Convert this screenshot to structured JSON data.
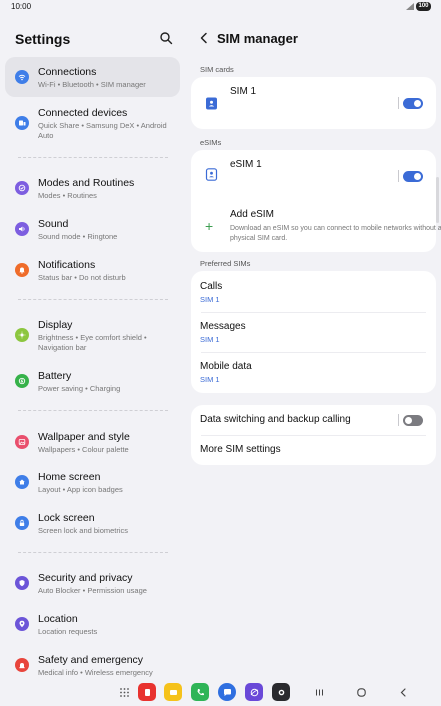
{
  "status": {
    "time": "10:00",
    "battery": "100"
  },
  "settings": {
    "title": "Settings",
    "items": [
      {
        "title": "Connections",
        "sub": "Wi-Fi  •  Bluetooth  •  SIM manager",
        "icon": "wifi-icon",
        "color": "#3f7ee8"
      },
      {
        "title": "Connected devices",
        "sub": "Quick Share  •  Samsung DeX  •  Android Auto",
        "icon": "devices-icon",
        "color": "#3f7ee8"
      },
      {
        "title": "Modes and Routines",
        "sub": "Modes  •  Routines",
        "icon": "check-circle-icon",
        "color": "#7d5ee0"
      },
      {
        "title": "Sound",
        "sub": "Sound mode  •  Ringtone",
        "icon": "speaker-icon",
        "color": "#7d5ee0"
      },
      {
        "title": "Notifications",
        "sub": "Status bar  •  Do not disturb",
        "icon": "bell-icon",
        "color": "#ef6c2a"
      },
      {
        "title": "Display",
        "sub": "Brightness  •  Eye comfort shield  •  Navigation bar",
        "icon": "sun-icon",
        "color": "#8cc63f"
      },
      {
        "title": "Battery",
        "sub": "Power saving  •  Charging",
        "icon": "battery-icon",
        "color": "#36b24a"
      },
      {
        "title": "Wallpaper and style",
        "sub": "Wallpapers  •  Colour palette",
        "icon": "image-icon",
        "color": "#e94f6d"
      },
      {
        "title": "Home screen",
        "sub": "Layout  •  App icon badges",
        "icon": "home-icon",
        "color": "#3f7ee8"
      },
      {
        "title": "Lock screen",
        "sub": "Screen lock and biometrics",
        "icon": "lock-icon",
        "color": "#3f7ee8"
      },
      {
        "title": "Security and privacy",
        "sub": "Auto Blocker  •  Permission usage",
        "icon": "shield-icon",
        "color": "#6c55d8"
      },
      {
        "title": "Location",
        "sub": "Location requests",
        "icon": "location-pin-icon",
        "color": "#6c55d8"
      },
      {
        "title": "Safety and emergency",
        "sub": "Medical info  •  Wireless emergency",
        "icon": "emergency-icon",
        "color": "#e8453c"
      }
    ]
  },
  "sim": {
    "title": "SIM manager",
    "section_sim_cards": "SIM cards",
    "sim1": "SIM 1",
    "section_esims": "eSIMs",
    "esim1": "eSIM 1",
    "add_esim": "Add eSIM",
    "add_esim_desc": "Download an eSIM so you can connect to mobile networks without a physical SIM card.",
    "section_preferred": "Preferred SIMs",
    "calls": "Calls",
    "calls_sim": "SIM 1",
    "messages": "Messages",
    "messages_sim": "SIM 1",
    "mobile_data": "Mobile data",
    "mobile_data_sim": "SIM 1",
    "data_switching": "Data switching and backup calling",
    "more_settings": "More SIM settings",
    "accent": "#3b6bd6"
  }
}
